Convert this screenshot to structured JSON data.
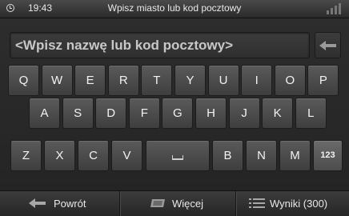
{
  "status_bar": {
    "time": "19:43",
    "title": "Wpisz miasto lub kod pocztowy",
    "clock_icon": "clock-icon",
    "signal_icon": "signal-strength-icon"
  },
  "input": {
    "placeholder": "<Wpisz nazwę lub kod pocztowy>"
  },
  "backspace": {
    "icon": "backspace-arrow-icon"
  },
  "keyboard": {
    "row1": [
      "Q",
      "W",
      "E",
      "R",
      "T",
      "Y",
      "U",
      "I",
      "O",
      "P"
    ],
    "row2": [
      "A",
      "S",
      "D",
      "F",
      "G",
      "H",
      "J",
      "K",
      "L"
    ],
    "row3": [
      "Z",
      "X",
      "C",
      "V",
      "B",
      "N",
      "M"
    ],
    "numeric_key": "123",
    "space_icon": "space-bar-icon"
  },
  "bottom_bar": {
    "back_label": "Powrót",
    "back_icon": "back-arrow-icon",
    "more_label": "Więcej",
    "more_icon": "more-icon",
    "results_label": "Wyniki (300)",
    "results_icon": "list-icon"
  },
  "colors": {
    "background": "#2b2b2b",
    "key": "#4a4a4a",
    "text": "#f2f2f2",
    "placeholder": "#c8c8c8"
  }
}
